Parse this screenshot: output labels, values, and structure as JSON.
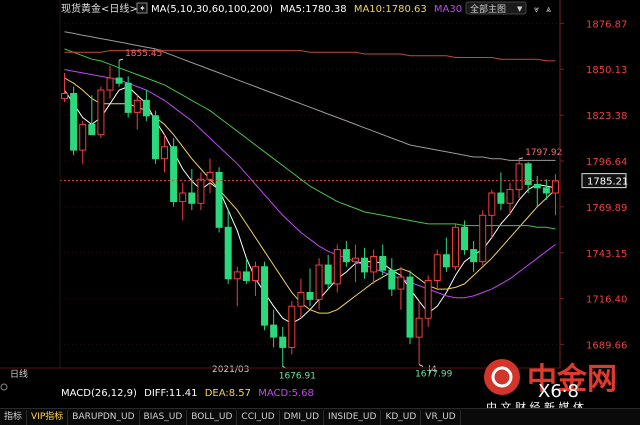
{
  "header": {
    "symbol": "现货黄金",
    "period_label": "<日线>",
    "indicator_icon": "ma-legend-icon",
    "ma_params": "MA(5,10,30,60,100,200)",
    "ma5": "MA5:1780.38",
    "ma10": "MA10:1780.63",
    "ma30": "MA30",
    "main_chart_button": "全部主图",
    "nav_icons": [
      "chevron-down-icon",
      "chevron-up-icon"
    ]
  },
  "colors": {
    "up": "#ef3f3f",
    "down": "#2bd97c",
    "ma5": "#ffffff",
    "ma10": "#f2d45a",
    "ma30": "#c048f0",
    "ma60": "#46c34a",
    "ma100": "#9a9a9a",
    "ma200": "#c14a36",
    "axis_text": "#ef3f3f",
    "price_line": "#ef3f3f"
  },
  "chart_data": {
    "type": "candlestick",
    "ylim": [
      1676,
      1880
    ],
    "y_ticks": [
      "1876.87",
      "1850.13",
      "1823.38",
      "1796.64",
      "1769.89",
      "1743.15",
      "1716.40",
      "1689.66"
    ],
    "current_price": "1785.21",
    "x_labels": [
      "2021/03",
      "|4"
    ],
    "annotations": [
      {
        "label": "1855.45",
        "value": 1855.45
      },
      {
        "label": "1797.92",
        "value": 1797.92
      },
      {
        "label": "1676.91",
        "value": 1676.91
      },
      {
        "label": "1677.99",
        "value": 1677.99
      }
    ],
    "candles": [
      {
        "o": 1833,
        "h": 1848,
        "l": 1831,
        "c": 1836
      },
      {
        "o": 1836,
        "h": 1840,
        "l": 1800,
        "c": 1803
      },
      {
        "o": 1803,
        "h": 1820,
        "l": 1795,
        "c": 1818
      },
      {
        "o": 1818,
        "h": 1835,
        "l": 1812,
        "c": 1812
      },
      {
        "o": 1812,
        "h": 1840,
        "l": 1810,
        "c": 1838
      },
      {
        "o": 1838,
        "h": 1852,
        "l": 1833,
        "c": 1845
      },
      {
        "o": 1845,
        "h": 1855.45,
        "l": 1840,
        "c": 1842
      },
      {
        "o": 1842,
        "h": 1846,
        "l": 1822,
        "c": 1825
      },
      {
        "o": 1825,
        "h": 1835,
        "l": 1815,
        "c": 1832
      },
      {
        "o": 1832,
        "h": 1838,
        "l": 1820,
        "c": 1823
      },
      {
        "o": 1823,
        "h": 1826,
        "l": 1795,
        "c": 1798
      },
      {
        "o": 1798,
        "h": 1812,
        "l": 1790,
        "c": 1805
      },
      {
        "o": 1805,
        "h": 1810,
        "l": 1770,
        "c": 1773
      },
      {
        "o": 1773,
        "h": 1784,
        "l": 1762,
        "c": 1778
      },
      {
        "o": 1778,
        "h": 1792,
        "l": 1768,
        "c": 1772
      },
      {
        "o": 1772,
        "h": 1790,
        "l": 1768,
        "c": 1786
      },
      {
        "o": 1786,
        "h": 1798,
        "l": 1778,
        "c": 1790
      },
      {
        "o": 1790,
        "h": 1793,
        "l": 1755,
        "c": 1758
      },
      {
        "o": 1758,
        "h": 1768,
        "l": 1725,
        "c": 1728
      },
      {
        "o": 1728,
        "h": 1735,
        "l": 1712,
        "c": 1732
      },
      {
        "o": 1732,
        "h": 1740,
        "l": 1725,
        "c": 1727
      },
      {
        "o": 1727,
        "h": 1738,
        "l": 1718,
        "c": 1735
      },
      {
        "o": 1735,
        "h": 1738,
        "l": 1698,
        "c": 1701
      },
      {
        "o": 1701,
        "h": 1710,
        "l": 1688,
        "c": 1694
      },
      {
        "o": 1694,
        "h": 1700,
        "l": 1676.91,
        "c": 1688
      },
      {
        "o": 1688,
        "h": 1715,
        "l": 1684,
        "c": 1712
      },
      {
        "o": 1712,
        "h": 1728,
        "l": 1705,
        "c": 1720
      },
      {
        "o": 1720,
        "h": 1734,
        "l": 1712,
        "c": 1716
      },
      {
        "o": 1716,
        "h": 1740,
        "l": 1710,
        "c": 1736
      },
      {
        "o": 1736,
        "h": 1742,
        "l": 1722,
        "c": 1725
      },
      {
        "o": 1725,
        "h": 1748,
        "l": 1720,
        "c": 1745
      },
      {
        "o": 1745,
        "h": 1750,
        "l": 1735,
        "c": 1738
      },
      {
        "o": 1738,
        "h": 1748,
        "l": 1726,
        "c": 1740
      },
      {
        "o": 1740,
        "h": 1746,
        "l": 1728,
        "c": 1732
      },
      {
        "o": 1732,
        "h": 1745,
        "l": 1725,
        "c": 1741
      },
      {
        "o": 1741,
        "h": 1748,
        "l": 1730,
        "c": 1733
      },
      {
        "o": 1733,
        "h": 1740,
        "l": 1718,
        "c": 1722
      },
      {
        "o": 1722,
        "h": 1735,
        "l": 1710,
        "c": 1729
      },
      {
        "o": 1729,
        "h": 1733,
        "l": 1690,
        "c": 1694
      },
      {
        "o": 1694,
        "h": 1715,
        "l": 1677.99,
        "c": 1705
      },
      {
        "o": 1705,
        "h": 1730,
        "l": 1700,
        "c": 1727
      },
      {
        "o": 1727,
        "h": 1745,
        "l": 1722,
        "c": 1742
      },
      {
        "o": 1742,
        "h": 1752,
        "l": 1732,
        "c": 1735
      },
      {
        "o": 1735,
        "h": 1760,
        "l": 1733,
        "c": 1758
      },
      {
        "o": 1758,
        "h": 1762,
        "l": 1742,
        "c": 1745
      },
      {
        "o": 1745,
        "h": 1750,
        "l": 1732,
        "c": 1738
      },
      {
        "o": 1738,
        "h": 1768,
        "l": 1736,
        "c": 1765
      },
      {
        "o": 1765,
        "h": 1780,
        "l": 1752,
        "c": 1778
      },
      {
        "o": 1778,
        "h": 1790,
        "l": 1768,
        "c": 1772
      },
      {
        "o": 1772,
        "h": 1784,
        "l": 1765,
        "c": 1780
      },
      {
        "o": 1780,
        "h": 1797.92,
        "l": 1775,
        "c": 1795
      },
      {
        "o": 1795,
        "h": 1796,
        "l": 1778,
        "c": 1783
      },
      {
        "o": 1783,
        "h": 1788,
        "l": 1770,
        "c": 1781
      },
      {
        "o": 1781,
        "h": 1786,
        "l": 1774,
        "c": 1778
      },
      {
        "o": 1778,
        "h": 1789,
        "l": 1765,
        "c": 1785
      }
    ],
    "ma_series": [
      {
        "key": "ma5",
        "color": "#ffffff",
        "values": [
          1838,
          1830,
          1822,
          1818,
          1822,
          1830,
          1838,
          1840,
          1835,
          1830,
          1820,
          1812,
          1802,
          1792,
          1785,
          1780,
          1784,
          1780,
          1768,
          1756,
          1740,
          1728,
          1720,
          1712,
          1705,
          1702,
          1705,
          1710,
          1716,
          1722,
          1728,
          1732,
          1737,
          1738,
          1738,
          1737,
          1733,
          1730,
          1722,
          1715,
          1708,
          1712,
          1720,
          1730,
          1738,
          1742,
          1745,
          1752,
          1760,
          1766,
          1774,
          1780,
          1783,
          1782,
          1781
        ]
      },
      {
        "key": "ma10",
        "color": "#f2d45a",
        "values": [
          1845,
          1842,
          1838,
          1833,
          1830,
          1830,
          1830,
          1830,
          1828,
          1826,
          1822,
          1818,
          1812,
          1805,
          1798,
          1792,
          1786,
          1780,
          1774,
          1768,
          1760,
          1752,
          1744,
          1736,
          1728,
          1720,
          1714,
          1710,
          1708,
          1708,
          1710,
          1714,
          1718,
          1722,
          1726,
          1729,
          1732,
          1734,
          1732,
          1728,
          1724,
          1722,
          1722,
          1723,
          1725,
          1730,
          1735,
          1740,
          1746,
          1752,
          1758,
          1764,
          1770,
          1775,
          1780
        ]
      },
      {
        "key": "ma30",
        "color": "#c048f0",
        "values": [
          1850,
          1849,
          1848,
          1847,
          1846,
          1845,
          1844,
          1842,
          1840,
          1838,
          1835,
          1832,
          1828,
          1824,
          1820,
          1815,
          1810,
          1805,
          1800,
          1795,
          1789,
          1783,
          1777,
          1771,
          1765,
          1760,
          1755,
          1751,
          1747,
          1744,
          1742,
          1740,
          1738,
          1736,
          1734,
          1732,
          1730,
          1728,
          1726,
          1724,
          1722,
          1720,
          1718,
          1717,
          1717,
          1718,
          1720,
          1722,
          1725,
          1728,
          1732,
          1736,
          1740,
          1744,
          1748
        ]
      },
      {
        "key": "ma60",
        "color": "#46c34a",
        "values": [
          1862,
          1860,
          1858,
          1856,
          1855,
          1853,
          1851,
          1849,
          1847,
          1845,
          1843,
          1841,
          1838,
          1835,
          1832,
          1829,
          1826,
          1822,
          1818,
          1814,
          1810,
          1806,
          1802,
          1798,
          1794,
          1790,
          1786,
          1782,
          1779,
          1776,
          1773,
          1771,
          1769,
          1767,
          1766,
          1765,
          1764,
          1763,
          1762,
          1761,
          1760,
          1760,
          1760,
          1760,
          1759,
          1759,
          1759,
          1759,
          1759,
          1759,
          1759,
          1759,
          1758,
          1758,
          1757
        ]
      },
      {
        "key": "ma100",
        "color": "#9a9a9a",
        "values": [
          1872,
          1871,
          1870,
          1869,
          1868,
          1867,
          1866,
          1865,
          1864,
          1863,
          1862,
          1860,
          1858,
          1856,
          1854,
          1852,
          1850,
          1848,
          1846,
          1844,
          1842,
          1840,
          1838,
          1836,
          1834,
          1832,
          1830,
          1828,
          1826,
          1824,
          1822,
          1820,
          1818,
          1816,
          1814,
          1812,
          1810,
          1808,
          1806,
          1805,
          1804,
          1803,
          1802,
          1801,
          1800,
          1799,
          1799,
          1798,
          1798,
          1797,
          1797,
          1797,
          1797,
          1797,
          1797
        ]
      },
      {
        "key": "ma200",
        "color": "#c14a36",
        "values": [
          1860,
          1860,
          1860,
          1860,
          1860,
          1861,
          1861,
          1861,
          1861,
          1861,
          1861,
          1861,
          1861,
          1861,
          1861,
          1861,
          1861,
          1861,
          1861,
          1861,
          1861,
          1861,
          1861,
          1861,
          1861,
          1861,
          1861,
          1860,
          1860,
          1860,
          1860,
          1860,
          1860,
          1859,
          1859,
          1859,
          1859,
          1859,
          1858,
          1858,
          1858,
          1858,
          1858,
          1857,
          1857,
          1857,
          1857,
          1857,
          1856,
          1856,
          1856,
          1856,
          1856,
          1855,
          1855
        ]
      }
    ]
  },
  "macd_panel": {
    "period_label": "日线",
    "params": "MACD(26,12,9)",
    "diff": "DIFF:11.41",
    "dea": "DEA:8.57",
    "macd": "MACD:5.68"
  },
  "bottom_tabs": [
    "指标",
    "VIP指标",
    "BARUPDN_UD",
    "BIAS_UD",
    "BOLL_UD",
    "CCI_UD",
    "DMI_UD",
    "INSIDE_UD",
    "KD_UD",
    "VR_UD"
  ],
  "watermark": {
    "brand": "中金网",
    "site": "X6·8",
    "slogan": "中 文 财 经 新 媒 体"
  }
}
